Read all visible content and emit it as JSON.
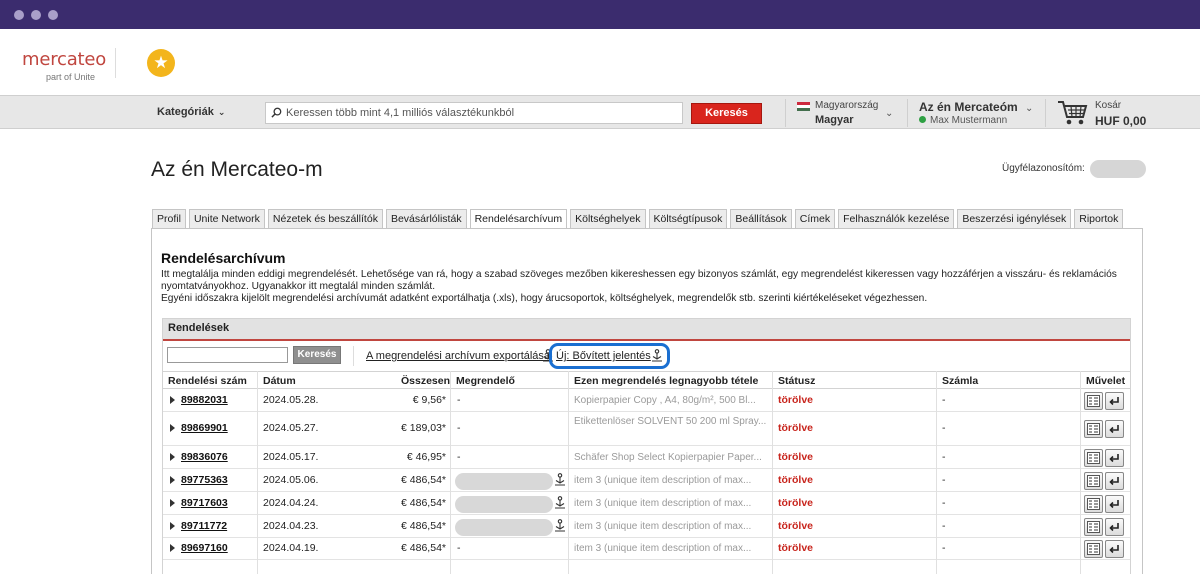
{
  "brand": {
    "logo_text": "mercateo",
    "logo_sub": "part of Unite"
  },
  "nav": {
    "categories_label": "Kategóriák",
    "search_placeholder": "Keressen több mint 4,1 milliós választékunkból",
    "search_button": "Keresés",
    "country_name": "Magyarország",
    "country_lang": "Magyar",
    "account_title": "Az én Mercateóm",
    "account_user": "Max Mustermann",
    "cart_label": "Kosár",
    "cart_total": "HUF 0,00"
  },
  "page": {
    "title": "Az én Mercateo-m",
    "customer_id_label": "Ügyfélazonosítóm:"
  },
  "tabs": [
    "Profil",
    "Unite Network",
    "Nézetek és beszállítók",
    "Bevásárlólisták",
    "Rendelésarchívum",
    "Költséghelyek",
    "Költségtípusok",
    "Beállítások",
    "Címek",
    "Felhasználók kezelése",
    "Beszerzési igénylések",
    "Riportok"
  ],
  "active_tab": "Rendelésarchívum",
  "section": {
    "title": "Rendelésarchívum",
    "intro_1": "Itt megtalálja minden eddigi megrendelését. Lehetősége van rá, hogy a szabad szöveges mezőben kikereshessen egy bizonyos számlát, egy megrendelést kikeressen vagy hozzáférjen a visszáru- és reklamációs nyomtatványokhoz. Ugyanakkor itt megtalál minden számlát.",
    "intro_2": "Egyéni időszakra kijelölt megrendelési archívumát adatként exportálhatja (.xls), hogy árucsoportok, költséghelyek, megrendelők stb. szerinti kiértékeléseket végezhessen."
  },
  "orders": {
    "header": "Rendelések",
    "filter_button": "Keresés",
    "export_link": "A megrendelési archívum exportálása",
    "new_report_link": "Új: Bővített jelentés",
    "columns": {
      "order_no": "Rendelési szám",
      "date": "Dátum",
      "total": "Összesen",
      "orderer": "Megrendelő",
      "top_item": "Ezen megrendelés legnagyobb tétele",
      "status": "Státusz",
      "invoice": "Számla",
      "action": "Művelet"
    },
    "rows": [
      {
        "order_no": "89882031",
        "date": "2024.05.28.",
        "total": "€ 9,56*",
        "orderer": "-",
        "item": "Kopierpapier Copy , A4, 80g/m², 500 Bl...",
        "status": "törölve",
        "invoice": "-"
      },
      {
        "order_no": "89869901",
        "date": "2024.05.27.",
        "total": "€ 189,03*",
        "orderer": "-",
        "item": "Etikettenlöser SOLVENT 50 200 ml Spray...",
        "status": "törölve",
        "invoice": "-"
      },
      {
        "order_no": "89836076",
        "date": "2024.05.17.",
        "total": "€ 46,95*",
        "orderer": "-",
        "item": "Schäfer Shop Select Kopierpapier Paper...",
        "status": "törölve",
        "invoice": "-"
      },
      {
        "order_no": "89775363",
        "date": "2024.05.06.",
        "total": "€ 486,54*",
        "orderer": "",
        "item": "item 3 (unique item description of max...",
        "status": "törölve",
        "invoice": "-"
      },
      {
        "order_no": "89717603",
        "date": "2024.04.24.",
        "total": "€ 486,54*",
        "orderer": "",
        "item": "item 3 (unique item description of max...",
        "status": "törölve",
        "invoice": "-"
      },
      {
        "order_no": "89711772",
        "date": "2024.04.23.",
        "total": "€ 486,54*",
        "orderer": "",
        "item": "item 3 (unique item description of max...",
        "status": "törölve",
        "invoice": "-"
      },
      {
        "order_no": "89697160",
        "date": "2024.04.19.",
        "total": "€ 486,54*",
        "orderer": "-",
        "item": "item 3 (unique item description of max...",
        "status": "törölve",
        "invoice": "-"
      }
    ]
  },
  "colors": {
    "accent_red": "#d9251d",
    "status_red": "#c8241c",
    "highlight_blue": "#1a6fd1",
    "chrome_purple": "#3b2c6e"
  }
}
